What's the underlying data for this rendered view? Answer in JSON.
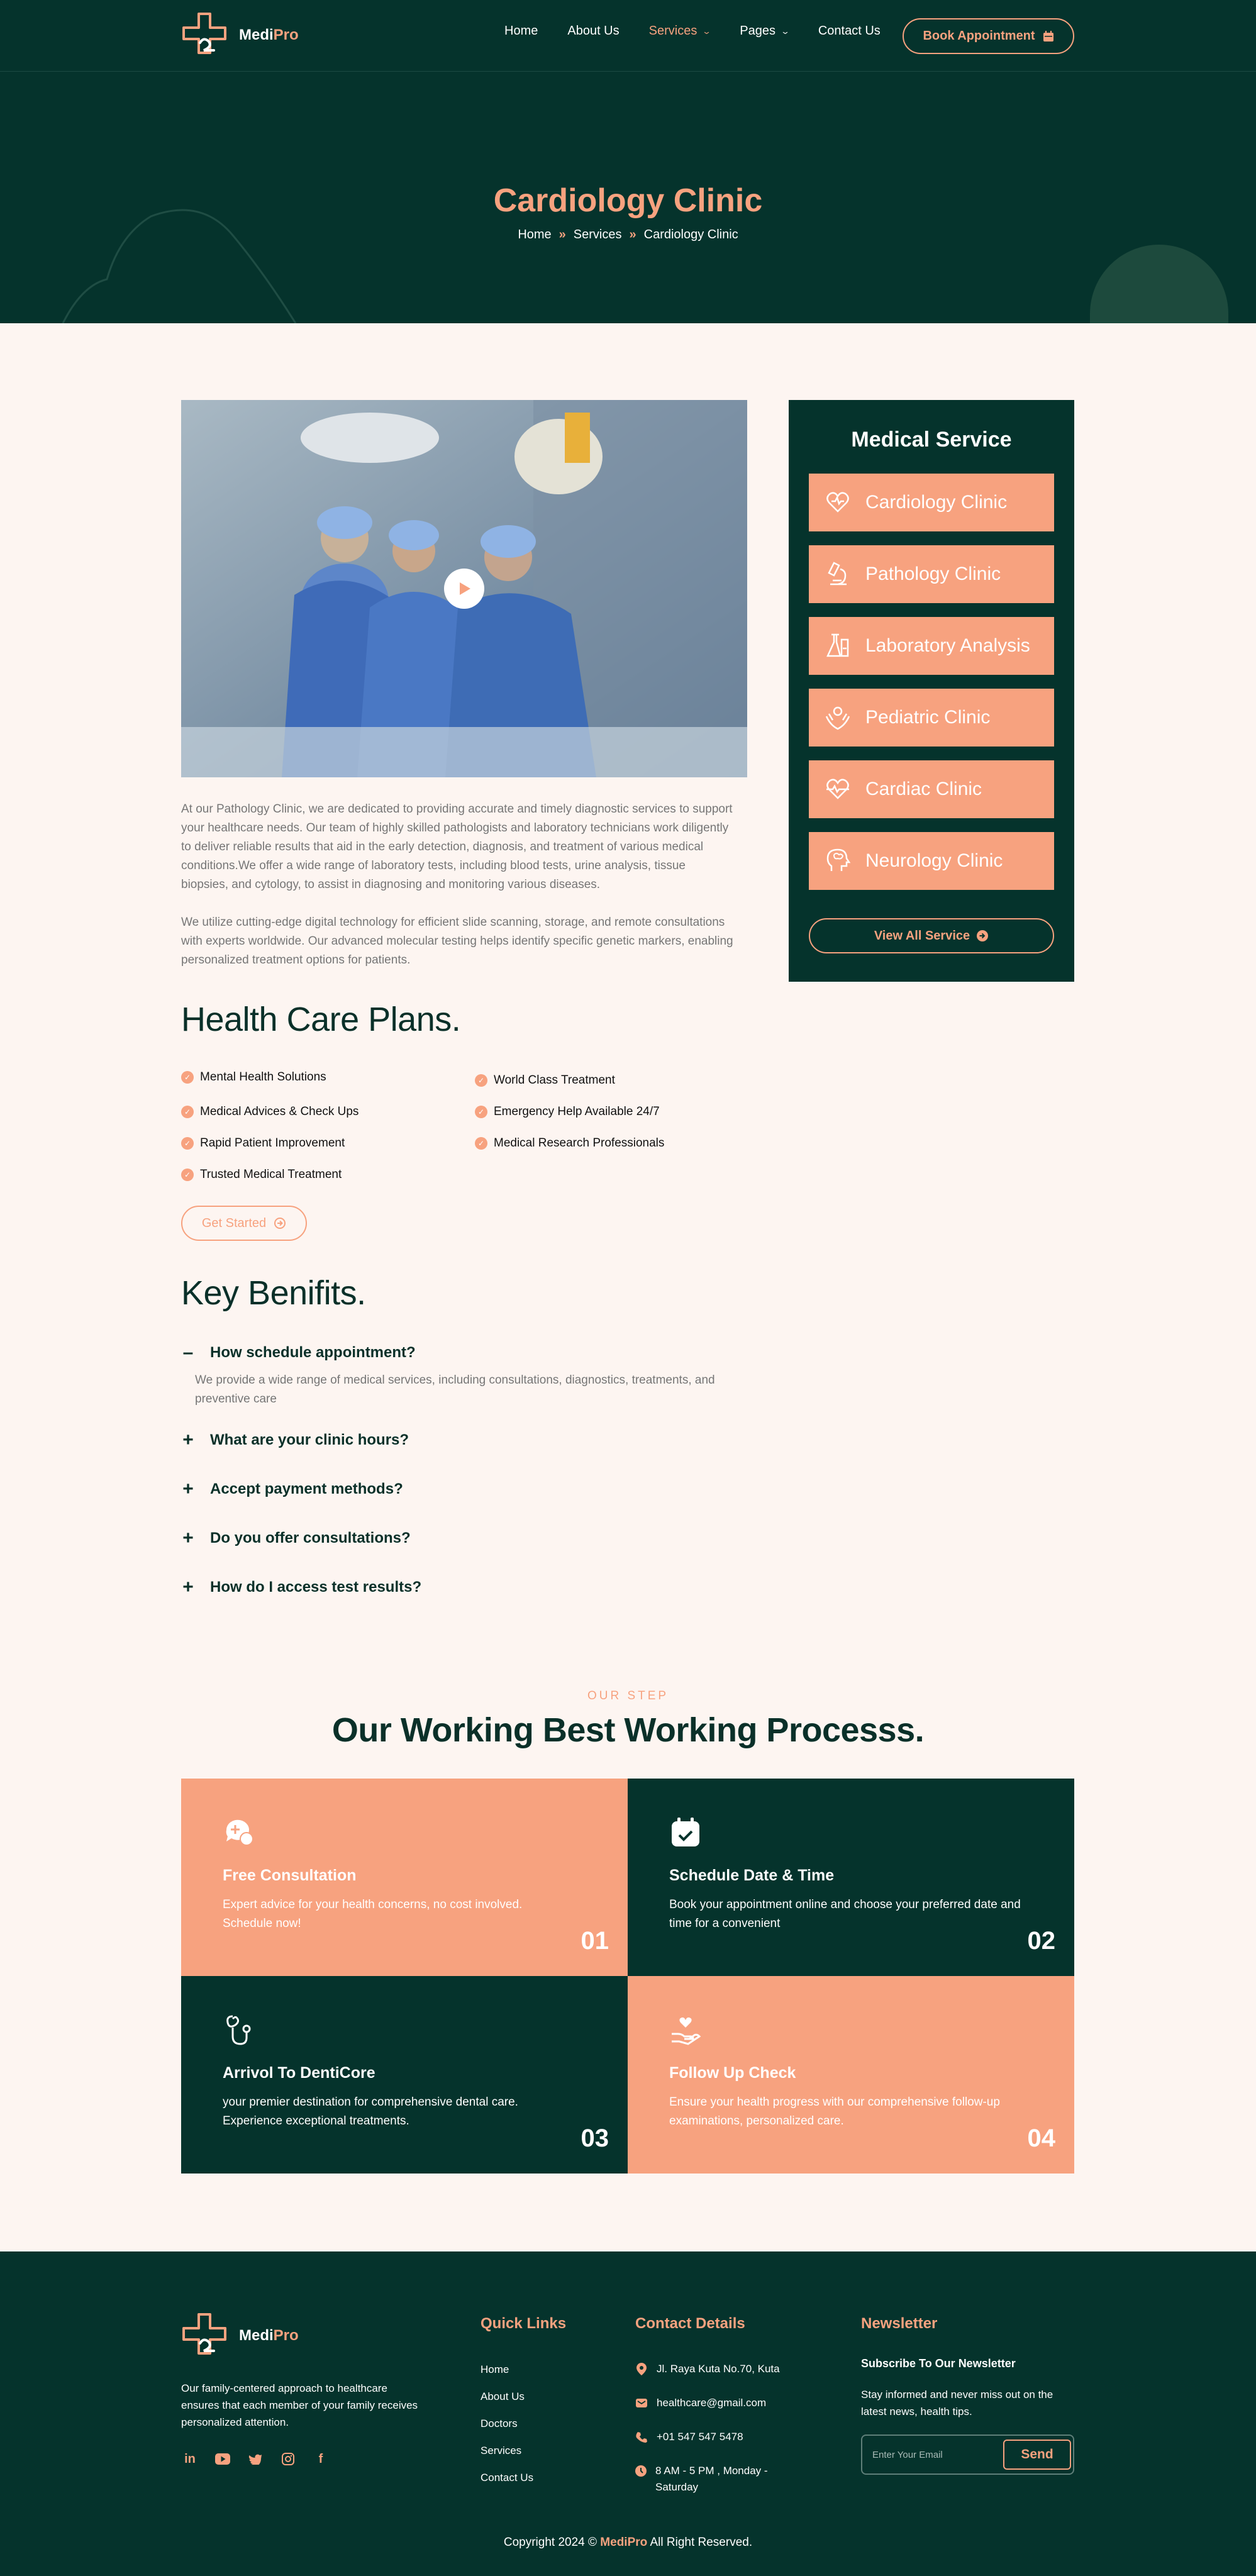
{
  "brand": {
    "name_main": "Medi",
    "name_accent": "Pro",
    "accent_color": "#f7a27f",
    "dark_color": "#05332c"
  },
  "nav": {
    "items": [
      {
        "label": "Home",
        "active": false,
        "dropdown": false
      },
      {
        "label": "About Us",
        "active": false,
        "dropdown": false
      },
      {
        "label": "Services",
        "active": true,
        "dropdown": true
      },
      {
        "label": "Pages",
        "active": false,
        "dropdown": true
      },
      {
        "label": "Contact Us",
        "active": false,
        "dropdown": false
      }
    ],
    "book_label": "Book Appointment",
    "book_icon": "calendar-icon"
  },
  "hero": {
    "title": "Cardiology Clinic",
    "breadcrumb": [
      "Home",
      "Services",
      "Cardiology Clinic"
    ]
  },
  "main": {
    "paragraph_1": "At our Pathology Clinic, we are dedicated to providing accurate and timely diagnostic services to support your healthcare needs. Our team of highly skilled pathologists and laboratory technicians work diligently to deliver reliable results that aid in the early detection, diagnosis, and treatment of various medical conditions.We offer a wide range of laboratory tests, including blood tests, urine analysis, tissue biopsies, and cytology, to assist in diagnosing and monitoring various diseases.",
    "paragraph_2": "We utilize cutting-edge digital technology for efficient slide scanning, storage, and remote consultations with experts worldwide. Our advanced molecular testing helps identify specific genetic markers, enabling personalized treatment options for patients.",
    "plans_title": "Health Care Plans.",
    "plans_left": [
      "Mental Health Solutions",
      "Medical Advices & Check Ups",
      "Rapid Patient Improvement",
      "Trusted Medical Treatment"
    ],
    "plans_right": [
      "World Class Treatment",
      "Emergency Help Available 24/7",
      "Medical Research Professionals"
    ],
    "get_started": "Get Started",
    "benefits_title": "Key Benifits.",
    "faq": [
      {
        "q": "How schedule appointment?",
        "open": true,
        "a": "We provide a wide range of medical services, including consultations, diagnostics, treatments, and preventive care"
      },
      {
        "q": "What are your clinic hours?",
        "open": false
      },
      {
        "q": "Accept payment methods?",
        "open": false
      },
      {
        "q": "Do you offer consultations?",
        "open": false
      },
      {
        "q": "How do I access test results?",
        "open": false
      }
    ]
  },
  "sidebar": {
    "title": "Medical Service",
    "services": [
      {
        "label": "Cardiology Clinic",
        "icon": "heart-hand-icon"
      },
      {
        "label": "Pathology Clinic",
        "icon": "microscope-icon"
      },
      {
        "label": "Laboratory Analysis",
        "icon": "lab-flask-icon"
      },
      {
        "label": "Pediatric Clinic",
        "icon": "baby-hands-icon"
      },
      {
        "label": "Cardiac Clinic",
        "icon": "heartbeat-icon"
      },
      {
        "label": "Neurology Clinic",
        "icon": "brain-head-icon"
      }
    ],
    "view_all": "View All Service"
  },
  "process": {
    "eyebrow": "OUR STEP",
    "title": "Our Working Best Working Processs.",
    "steps": [
      {
        "title": "Free Consultation",
        "desc": "Expert advice for your health concerns, no cost involved. Schedule now!",
        "num": "01",
        "icon": "chat-medical-icon"
      },
      {
        "title": "Schedule Date & Time",
        "desc": "Book your appointment online and choose your preferred date and time for a convenient",
        "num": "02",
        "icon": "calendar-check-icon"
      },
      {
        "title": "Arrivol To DentiCore",
        "desc": "your premier destination for comprehensive dental care. Experience exceptional treatments.",
        "num": "03",
        "icon": "stethoscope-icon"
      },
      {
        "title": "Follow Up Check",
        "desc": "Ensure your health progress with our comprehensive follow-up examinations, personalized care.",
        "num": "04",
        "icon": "hand-heart-icon"
      }
    ]
  },
  "footer": {
    "about": "Our family-centered approach to healthcare ensures that each member of your family receives personalized attention.",
    "socials": [
      "linkedin-icon",
      "youtube-icon",
      "twitter-icon",
      "instagram-icon",
      "facebook-icon"
    ],
    "quick_title": "Quick Links",
    "quick_links": [
      "Home",
      "About Us",
      "Doctors",
      "Services",
      "Contact Us"
    ],
    "contact_title": "Contact Details",
    "contacts": [
      {
        "icon": "location-pin-icon",
        "text": "Jl. Raya Kuta No.70, Kuta"
      },
      {
        "icon": "email-icon",
        "text": "healthcare@gmail.com"
      },
      {
        "icon": "phone-icon",
        "text": "+01 547 547 5478"
      },
      {
        "icon": "clock-icon",
        "text": "8 AM - 5 PM , Monday - Saturday"
      }
    ],
    "news_title": "Newsletter",
    "news_sub": "Subscribe To Our Newsletter",
    "news_text": "Stay informed and never miss out on the latest news, health tips.",
    "email_placeholder": "Enter Your Email",
    "send_label": "Send",
    "copyright_pre": "Copyright 2024 ©",
    "copyright_brand": "MediPro",
    "copyright_post": "All Right Reserved."
  }
}
